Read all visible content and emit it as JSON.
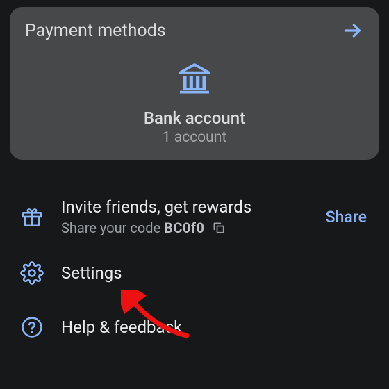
{
  "card": {
    "title": "Payment methods",
    "item": {
      "title": "Bank account",
      "subtitle": "1 account"
    }
  },
  "invite": {
    "title": "Invite friends, get rewards",
    "sub_prefix": "Share your code ",
    "code": "BC0f0",
    "share_label": "Share"
  },
  "settings": {
    "label": "Settings"
  },
  "help": {
    "label": "Help & feedback"
  },
  "colors": {
    "accent": "#8ab4f8"
  }
}
